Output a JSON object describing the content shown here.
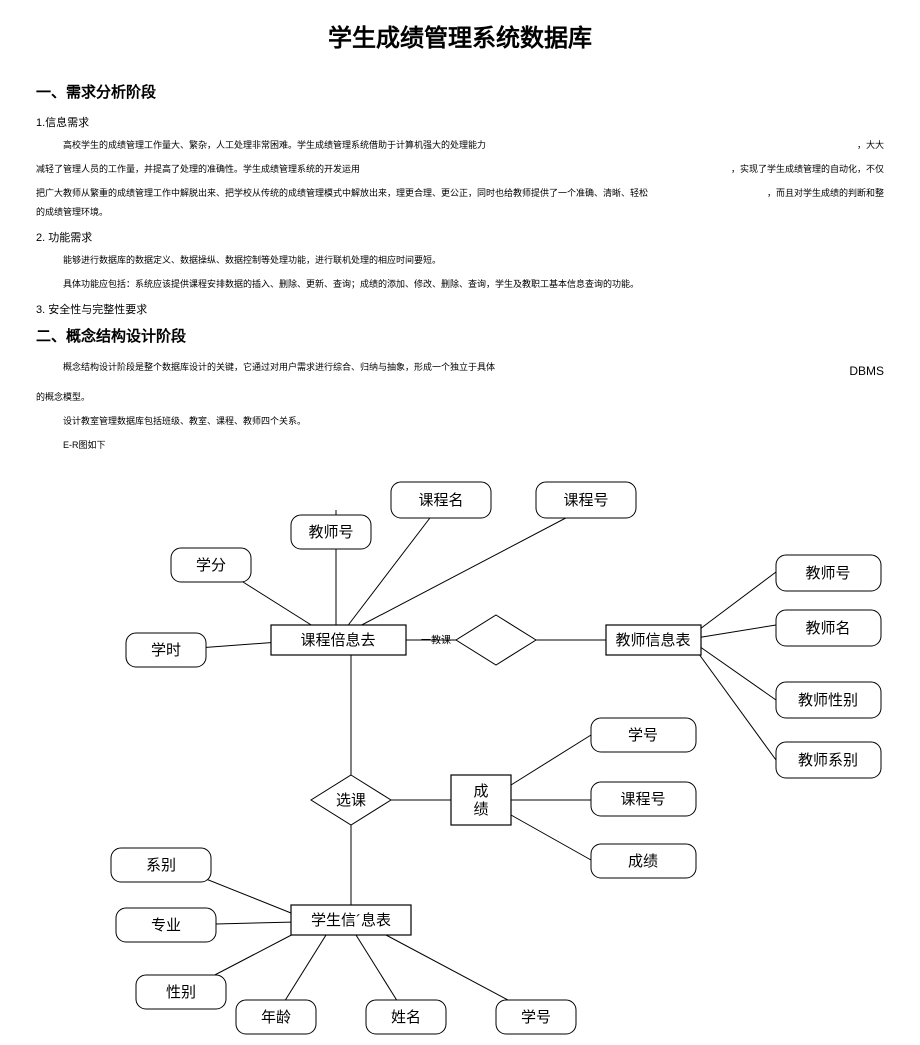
{
  "title": "学生成绩管理系统数据库",
  "sec1": {
    "heading": "一、需求分析阶段",
    "item1_label": "1.信息需求",
    "p1a": "高校学生的成绩管理工作量大、繁杂，人工处理非常困难。学生成绩管理系统借助于计算机强大的处理能力",
    "p1a_right": "，大大",
    "p2a": "减轻了管理人员的工作量，并提高了处理的准确性。学生成绩管理系统的开发运用",
    "p2a_right": "，实现了学生成绩管理的自动化，不仅",
    "p3a": "把广大教师从繁重的成绩管理工作中解脱出来、把学校从传统的成绩管理模式中解放出来，理更合理、更公正，同时也给教师提供了一个准确、清晰、轻松的成绩管理环境。",
    "p3a_right": "，而且对学生成绩的判断和整",
    "item2_label": "2.   功能需求",
    "p4": "能够进行数据库的数据定义、数据操纵、数据控制等处理功能，进行联机处理的相应时间要短。",
    "p5": "具体功能应包括：系统应该提供课程安排数据的插入、删除、更新、查询；成绩的添加、修改、删除、查询，学生及教职工基本信息查询的功能。",
    "item3_label": "3.   安全性与完整性要求"
  },
  "sec2": {
    "heading": "二、概念结构设计阶段",
    "p1a": "概念结构设计阶段是整个数据库设计的关键，它通过对用户需求进行综合、归纳与抽象，形成一个独立于具体",
    "p1a_right": "DBMS",
    "p2": "的概念模型。",
    "p3": "设计教室管理数据库包括班级、教室、课程、教师四个关系。",
    "p4": "E-R图如下"
  },
  "er": {
    "course_name": "课程名",
    "course_id": "课程号",
    "teacher_id_top": "教师号",
    "credit": "学分",
    "hours": "学时",
    "course_info": "课程倍息去",
    "teach_rel": "一教课",
    "teacher_info": "教师信息表",
    "teacher_id": "教师号",
    "teacher_name": "教师名",
    "teacher_sex": "教师性别",
    "teacher_dept": "教师系别",
    "select_course": "选课",
    "score_entity": "成\n绩",
    "student_id_r": "学号",
    "course_id_r": "课程号",
    "score_attr": "成绩",
    "dept": "系别",
    "major": "专业",
    "sex": "性别",
    "student_info": "学生信´息表",
    "age": "年龄",
    "name": "姓名",
    "student_id": "学号"
  }
}
